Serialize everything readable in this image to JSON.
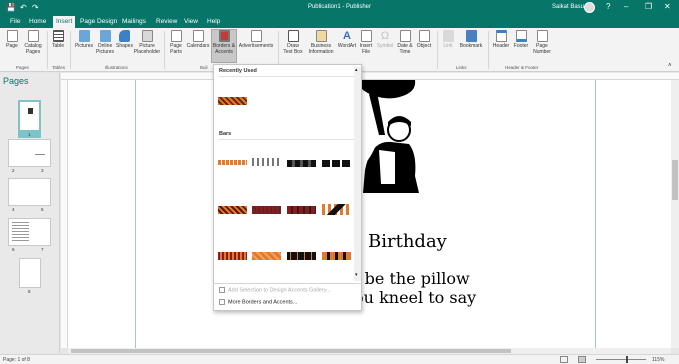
{
  "window": {
    "title": "Publication1 - Publisher",
    "user": "Saikat Basu",
    "help_icon": "?"
  },
  "quick_access": {
    "save_icon": "save-icon",
    "undo_icon": "undo-icon",
    "redo_icon": "redo-icon"
  },
  "tabs": [
    "File",
    "Home",
    "Insert",
    "Page Design",
    "Mailings",
    "Review",
    "View",
    "Help"
  ],
  "active_tab": "Insert",
  "ribbon": {
    "buttons": [
      {
        "label": "Page"
      },
      {
        "label": "Catalog\nPages"
      },
      {
        "label": "Table"
      },
      {
        "label": "Pictures"
      },
      {
        "label": "Online\nPictures"
      },
      {
        "label": "Shapes"
      },
      {
        "label": "Picture\nPlaceholder"
      },
      {
        "label": "Page\nParts"
      },
      {
        "label": "Calendars"
      },
      {
        "label": "Borders &\nAccents"
      },
      {
        "label": "Advertisements"
      },
      {
        "label": "Draw\nText Box"
      },
      {
        "label": "Business\nInformation"
      },
      {
        "label": "WordArt"
      },
      {
        "label": "Insert\nFile"
      },
      {
        "label": "Symbol"
      },
      {
        "label": "Date &\nTime"
      },
      {
        "label": "Object"
      },
      {
        "label": "Link"
      },
      {
        "label": "Bookmark"
      },
      {
        "label": "Header"
      },
      {
        "label": "Footer"
      },
      {
        "label": "Page\nNumber"
      }
    ],
    "groups": [
      "Pages",
      "Tables",
      "Illustrations",
      "Buil",
      "Links",
      "Header & Footer"
    ]
  },
  "colors": {
    "accent": "#077568",
    "ribbon_bg": "#f3f3f3",
    "orange": "#e07a2e",
    "dark_red": "#8b1a1a"
  },
  "pages_panel": {
    "title": "Pages",
    "pages": [
      "1",
      "2",
      "3",
      "4",
      "5",
      "6",
      "7",
      "8"
    ]
  },
  "document": {
    "title_text": "Birthday",
    "line1": "le be the pillow",
    "line2": "you kneel to say"
  },
  "dropdown": {
    "recently_used": "Recently Used",
    "bars": "Bars",
    "add_selection": "Add Selection to Design Accents Gallery...",
    "more": "More Borders and Accents..."
  },
  "status": {
    "page": "Page: 1 of 8",
    "zoom": "115%"
  }
}
